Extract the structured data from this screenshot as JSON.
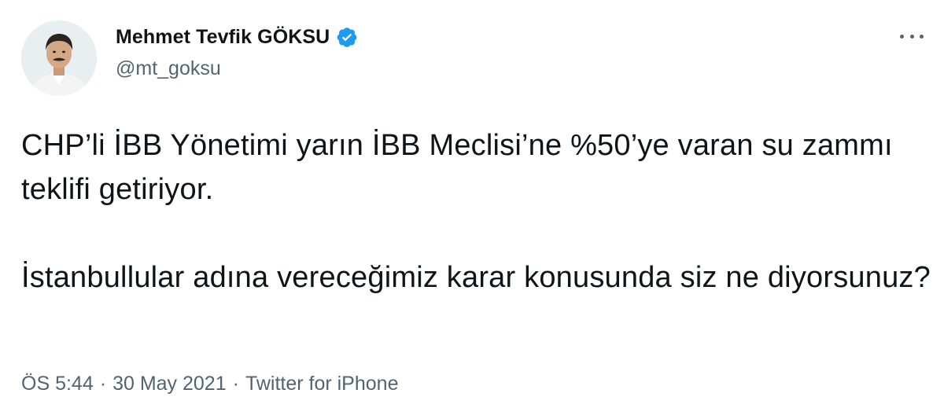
{
  "tweet": {
    "author": {
      "display_name": "Mehmet Tevfik GÖKSU",
      "handle": "@mt_goksu",
      "verified": true,
      "avatar_icon": "profile-photo"
    },
    "more_icon": "ellipsis-icon",
    "text": {
      "paragraph_1": "CHP’li İBB Yönetimi yarın İBB Meclisi’ne %50’ye varan su zammı teklifi getiriyor.",
      "paragraph_2": "İstanbullular adına vereceğimiz karar konusunda siz ne diyorsunuz?"
    },
    "meta": {
      "time": "ÖS 5:44",
      "separator": "·",
      "date": "30 May 2021",
      "source": "Twitter for iPhone"
    }
  },
  "colors": {
    "verified_blue": "#1d9bf0",
    "secondary_text": "#536471",
    "primary_text": "#0f1419"
  }
}
